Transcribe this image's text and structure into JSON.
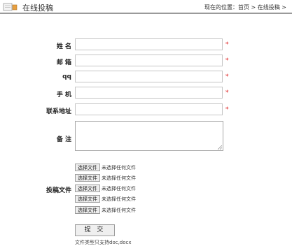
{
  "header": {
    "title": "在线投稿",
    "breadcrumb": {
      "prefix": "现在的位置：",
      "home": "首页",
      "sep1": " > ",
      "current": "在线投稿",
      "sep2": " >"
    }
  },
  "form": {
    "name_label": "姓 名",
    "email_label": "邮 箱",
    "qq_label": "qq",
    "phone_label": "手 机",
    "address_label": "联系地址",
    "remark_label": "备 注",
    "required_mark": "*",
    "name_value": "",
    "email_value": "",
    "qq_value": "",
    "phone_value": "",
    "address_value": "",
    "remark_value": "",
    "file_label": "投稿文件",
    "files": [
      {
        "button": "选择文件",
        "status": "未选择任何文件"
      },
      {
        "button": "选择文件",
        "status": "未选择任何文件"
      },
      {
        "button": "选择文件",
        "status": "未选择任何文件"
      },
      {
        "button": "选择文件",
        "status": "未选择任何文件"
      },
      {
        "button": "选择文件",
        "status": "未选择任何文件"
      }
    ],
    "submit_label": "提 交",
    "file_note": "文件类型只支持doc,docx"
  },
  "colors": {
    "required": "#e02020",
    "header_rule": "#9a9a9a"
  }
}
